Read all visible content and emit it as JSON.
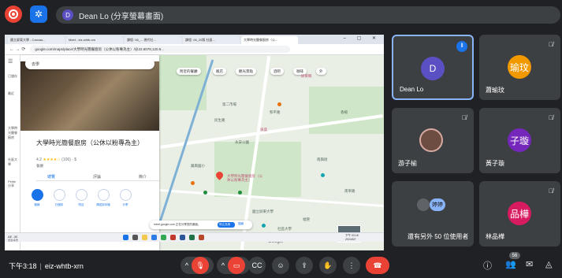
{
  "header": {
    "presenter_initial": "D",
    "presenter_text": "Dean Lo (分享螢幕畫面)"
  },
  "browser": {
    "tabs": [
      "國立屏東大學 - Canvas...",
      "Meet - eiz-whtb-xrn",
      "課程: 06_... 現代社...",
      "課程: 06_20版 社區...",
      "大學時光簡餐廚房（公..."
    ],
    "url": "google.com/maps/place/大學時光簡餐廚房（公休以粉專為主）/@22.6078,120.5...",
    "window_controls": "– ▢ ✕"
  },
  "maps": {
    "search_placeholder": "",
    "search_value": "去學",
    "place_title": "大學時光簡餐廚房（公休以粉專為主）",
    "rating": "4.2",
    "stars": "★★★★☆",
    "reviews": "(106)",
    "price": "· $",
    "category": "餐廳",
    "tabs": [
      "總覽",
      "評論",
      "簡介"
    ],
    "actions": [
      "路線",
      "已儲存",
      "附近",
      "傳送到手機",
      "分享"
    ],
    "chips": [
      "附近的餐廳",
      "飯店",
      "觀光景點",
      "酒吧",
      "咖啡",
      "外"
    ],
    "pin_label": "大學時光簡餐廚房（公休以粉專為主）",
    "labels": [
      "廣興國小",
      "永安公園",
      "國立屏東大學",
      "民生路",
      "和平路",
      "屏東縣",
      "泉盛",
      "第二市場",
      "南興街",
      "香楊",
      "福營",
      "社區大學",
      "南寧路"
    ],
    "notify_text": "meet.google.com 正在分享您的畫面。",
    "notify_stop": "停止共用",
    "notify_hide": "隱藏",
    "google_logo": "Google"
  },
  "taskbar": {
    "weather": "AE -30",
    "weather_sub": "低溫/多雲",
    "time": "下午 03:18",
    "date": "2024/6/7"
  },
  "rail": [
    "選單",
    "已儲存",
    "最近",
    "大學時光簡餐廚房",
    "社區大學",
    "Petite分享"
  ],
  "participants": [
    {
      "name": "Dean Lo",
      "initial": "D",
      "color": "#5b4fc4",
      "speaking": true
    },
    {
      "name": "蕭瑜玟",
      "initial": "瑜玟",
      "color": "#f29900",
      "muted": true
    },
    {
      "name": "游子榆",
      "initial": "",
      "color": "#6d4c41",
      "muted": true
    },
    {
      "name": "黃子璇",
      "initial": "子璇",
      "color": "#7627bb",
      "muted": true
    },
    {
      "name": "還有另外 50 位使用者",
      "initial": "婷婷",
      "color": "#8ab4f8"
    },
    {
      "name": "林品樺",
      "initial": "品樺",
      "color": "#d81b60",
      "muted": true
    }
  ],
  "footer": {
    "time": "下午3:18",
    "meeting_code": "eiz-whtb-xrn",
    "people_count": "56"
  },
  "colors": {
    "accent": "#1a73e8",
    "danger": "#ea4335",
    "bg": "#202124",
    "tile": "#3c4043"
  }
}
